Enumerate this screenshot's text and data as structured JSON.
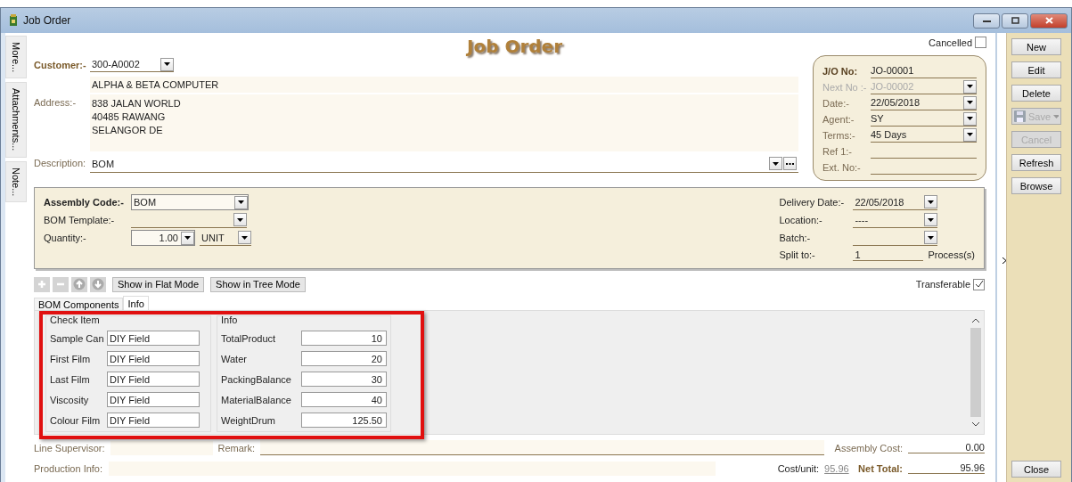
{
  "window": {
    "title": "Job Order",
    "controls": [
      {
        "kind": "minimize"
      },
      {
        "kind": "restore"
      },
      {
        "kind": "close"
      }
    ]
  },
  "side_tabs": [
    {
      "label": "More..."
    },
    {
      "label": "Attachments..."
    },
    {
      "label": "Note..."
    }
  ],
  "header": {
    "title": "Job Order",
    "cancelled": {
      "label": "Cancelled",
      "checked": false
    }
  },
  "customer": {
    "label": "Customer:-",
    "code": "300-A0002",
    "name": "ALPHA & BETA COMPUTER"
  },
  "address": {
    "label": "Address:-",
    "lines": [
      "838 JALAN WORLD",
      "40485 RAWANG",
      "SELANGOR DE"
    ]
  },
  "description": {
    "label": "Description:",
    "value": "BOM"
  },
  "doc_info": [
    {
      "label": "J/O No:",
      "value": "JO-00001",
      "kind": "heading",
      "disabled": false
    },
    {
      "label": "Next No :-",
      "value": "JO-00002",
      "kind": "dropdown",
      "disabled": true
    },
    {
      "label": "Date:-",
      "value": "22/05/2018",
      "kind": "dropdown",
      "disabled": false
    },
    {
      "label": "Agent:-",
      "value": "SY",
      "kind": "dropdown",
      "disabled": false
    },
    {
      "label": "Terms:-",
      "value": "45 Days",
      "kind": "dropdown",
      "disabled": false
    },
    {
      "label": "Ref 1:-",
      "kind": "line",
      "disabled": false
    },
    {
      "label": "Ext. No:-",
      "kind": "line",
      "disabled": false
    }
  ],
  "assembly": {
    "assembly_code": {
      "label": "Assembly Code:-",
      "value": "BOM"
    },
    "bom_template": {
      "label": "BOM Template:-"
    },
    "quantity": {
      "label": "Quantity:-",
      "value": "1.00",
      "unit": "UNIT"
    },
    "delivery_date": {
      "label": "Delivery Date:-",
      "value": "22/05/2018"
    },
    "location": {
      "label": "Location:-",
      "value": "----"
    },
    "batch": {
      "label": "Batch:-"
    },
    "split_to": {
      "label": "Split to:-",
      "value": "1",
      "suffix": "Process(s)"
    }
  },
  "toolbar": {
    "icons": [
      {
        "kind": "add"
      },
      {
        "kind": "remove"
      },
      {
        "kind": "up"
      },
      {
        "kind": "down"
      }
    ],
    "buttons": [
      "Show in Flat Mode",
      "Show in Tree Mode"
    ],
    "transferable": {
      "label": "Transferable",
      "checked": true
    }
  },
  "tabs": [
    {
      "label": "BOM Components",
      "selected": false
    },
    {
      "label": "Info",
      "selected": true
    }
  ],
  "info_groups": [
    {
      "title": "Check Item",
      "kind": "text",
      "fields": [
        {
          "label": "Sample Can",
          "value": "DIY Field"
        },
        {
          "label": "First Film",
          "value": "DIY Field"
        },
        {
          "label": "Last Film",
          "value": "DIY Field"
        },
        {
          "label": "Viscosity",
          "value": "DIY Field"
        },
        {
          "label": "Colour Film",
          "value": "DIY Field"
        }
      ]
    },
    {
      "title": "Info",
      "kind": "number",
      "fields": [
        {
          "label": "TotalProduct",
          "value": "10"
        },
        {
          "label": "Water",
          "value": "20"
        },
        {
          "label": "PackingBalance",
          "value": "30"
        },
        {
          "label": "MaterialBalance",
          "value": "40"
        },
        {
          "label": "WeightDrum",
          "value": "125.50"
        }
      ]
    }
  ],
  "footer": {
    "line_supervisor": {
      "label": "Line Supervisor:"
    },
    "remark": {
      "label": "Remark:"
    },
    "assembly_cost": {
      "label": "Assembly Cost:",
      "value": "0.00"
    },
    "production_info": {
      "label": "Production Info:"
    },
    "cost_unit": {
      "label": "Cost/unit:",
      "value": "95.96"
    },
    "net_total": {
      "label": "Net Total:",
      "value": "95.96"
    }
  },
  "actions": [
    {
      "label": "New",
      "kind": "plain",
      "disabled": false
    },
    {
      "label": "Edit",
      "kind": "plain",
      "disabled": false
    },
    {
      "label": "Delete",
      "kind": "plain",
      "disabled": false
    },
    {
      "label": "Save",
      "kind": "split",
      "disabled": true
    },
    {
      "label": "Cancel",
      "kind": "plain",
      "disabled": true
    },
    {
      "label": "Refresh",
      "kind": "plain",
      "disabled": false
    },
    {
      "label": "Browse",
      "kind": "plain",
      "disabled": false
    }
  ],
  "close_button": {
    "label": "Close"
  }
}
